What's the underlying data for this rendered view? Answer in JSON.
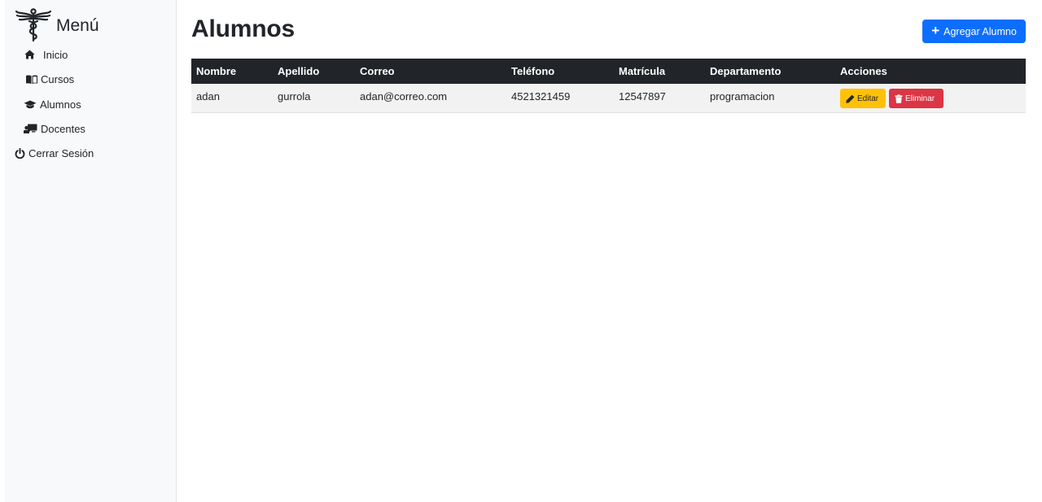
{
  "sidebar": {
    "title": "Menú",
    "items": [
      {
        "label": "Inicio",
        "icon": "home-icon"
      },
      {
        "label": "Cursos",
        "icon": "book-icon"
      },
      {
        "label": "Alumnos",
        "icon": "graduation-cap-icon"
      },
      {
        "label": "Docentes",
        "icon": "chalkboard-teacher-icon"
      },
      {
        "label": "Cerrar Sesión",
        "icon": "power-icon"
      }
    ]
  },
  "main": {
    "title": "Alumnos",
    "add_button": "Agregar Alumno"
  },
  "table": {
    "headers": [
      "Nombre",
      "Apellido",
      "Correo",
      "Teléfono",
      "Matrícula",
      "Departamento",
      "Acciones"
    ],
    "rows": [
      {
        "nombre": "adan",
        "apellido": "gurrola",
        "correo": "adan@correo.com",
        "telefono": "4521321459",
        "matricula": "12547897",
        "departamento": "programacion",
        "edit_label": "Editar",
        "delete_label": "Eliminar"
      }
    ]
  },
  "colors": {
    "primary": "#0d6efd",
    "warning": "#ffc107",
    "danger": "#dc3545",
    "table_header": "#212529",
    "sidebar_bg": "#f8f9fa"
  }
}
